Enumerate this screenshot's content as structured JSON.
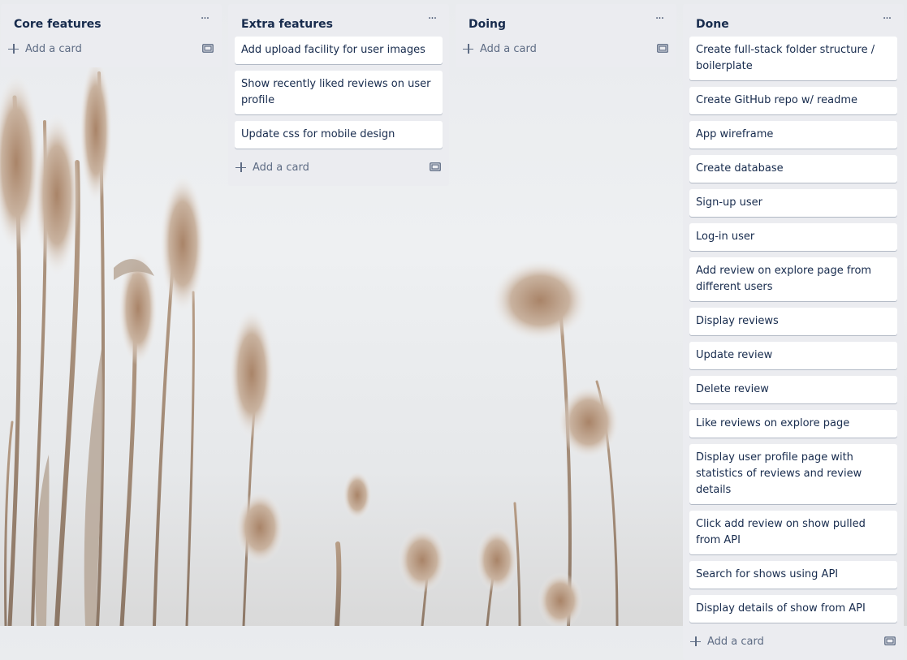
{
  "lists": [
    {
      "title": "Core features",
      "menu_label": "···",
      "cards": [],
      "add_label": "Add a card"
    },
    {
      "title": "Extra features",
      "menu_label": "···",
      "cards": [
        "Add upload facility for user images",
        "Show recently liked reviews on user profile",
        "Update css for mobile design"
      ],
      "add_label": "Add a card"
    },
    {
      "title": "Doing",
      "menu_label": "···",
      "cards": [],
      "add_label": "Add a card"
    },
    {
      "title": "Done",
      "menu_label": "···",
      "cards": [
        "Create full-stack folder structure / boilerplate",
        "Create GitHub repo w/ readme",
        "App wireframe",
        "Create database",
        "Sign-up user",
        "Log-in user",
        "Add review on explore page from different users",
        "Display reviews",
        "Update review",
        "Delete review",
        "Like reviews on explore page",
        "Display user profile page with statistics of reviews and review details",
        "Click add review on show pulled from API",
        "Search for shows using API",
        "Display details of show from API"
      ],
      "add_label": "Add a card"
    }
  ],
  "icons": {
    "menu": "ellipsis-icon",
    "add": "plus-icon",
    "template": "card-template-icon"
  },
  "colors": {
    "list_bg": "#ebecf0",
    "card_bg": "#ffffff",
    "text": "#172b4d",
    "muted": "#5e6c84"
  }
}
